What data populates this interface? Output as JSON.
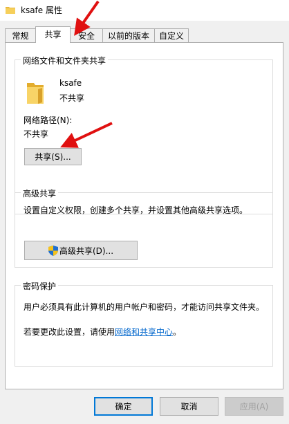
{
  "window": {
    "title": "ksafe 属性"
  },
  "tabs": [
    {
      "label": "常规"
    },
    {
      "label": "共享",
      "active": true
    },
    {
      "label": "安全"
    },
    {
      "label": "以前的版本"
    },
    {
      "label": "自定义"
    }
  ],
  "network_share": {
    "group_title": "网络文件和文件夹共享",
    "folder_name": "ksafe",
    "status": "不共享",
    "path_label": "网络路径(N):",
    "path_value": "不共享",
    "share_button": "共享(S)..."
  },
  "advanced_share": {
    "group_title": "高级共享",
    "description": "设置自定义权限，创建多个共享，并设置其他高级共享选项。",
    "button": "高级共享(D)..."
  },
  "password_protection": {
    "group_title": "密码保护",
    "description": "用户必须具有此计算机的用户帐户和密码，才能访问共享文件夹。",
    "change_prefix": "若要更改此设置，请使用",
    "link_text": "网络和共享中心",
    "change_suffix": "。"
  },
  "footer": {
    "ok": "确定",
    "cancel": "取消",
    "apply": "应用(A)"
  },
  "colors": {
    "accent": "#0078d7",
    "link": "#0066cc",
    "annotation_arrow": "#e01010"
  }
}
